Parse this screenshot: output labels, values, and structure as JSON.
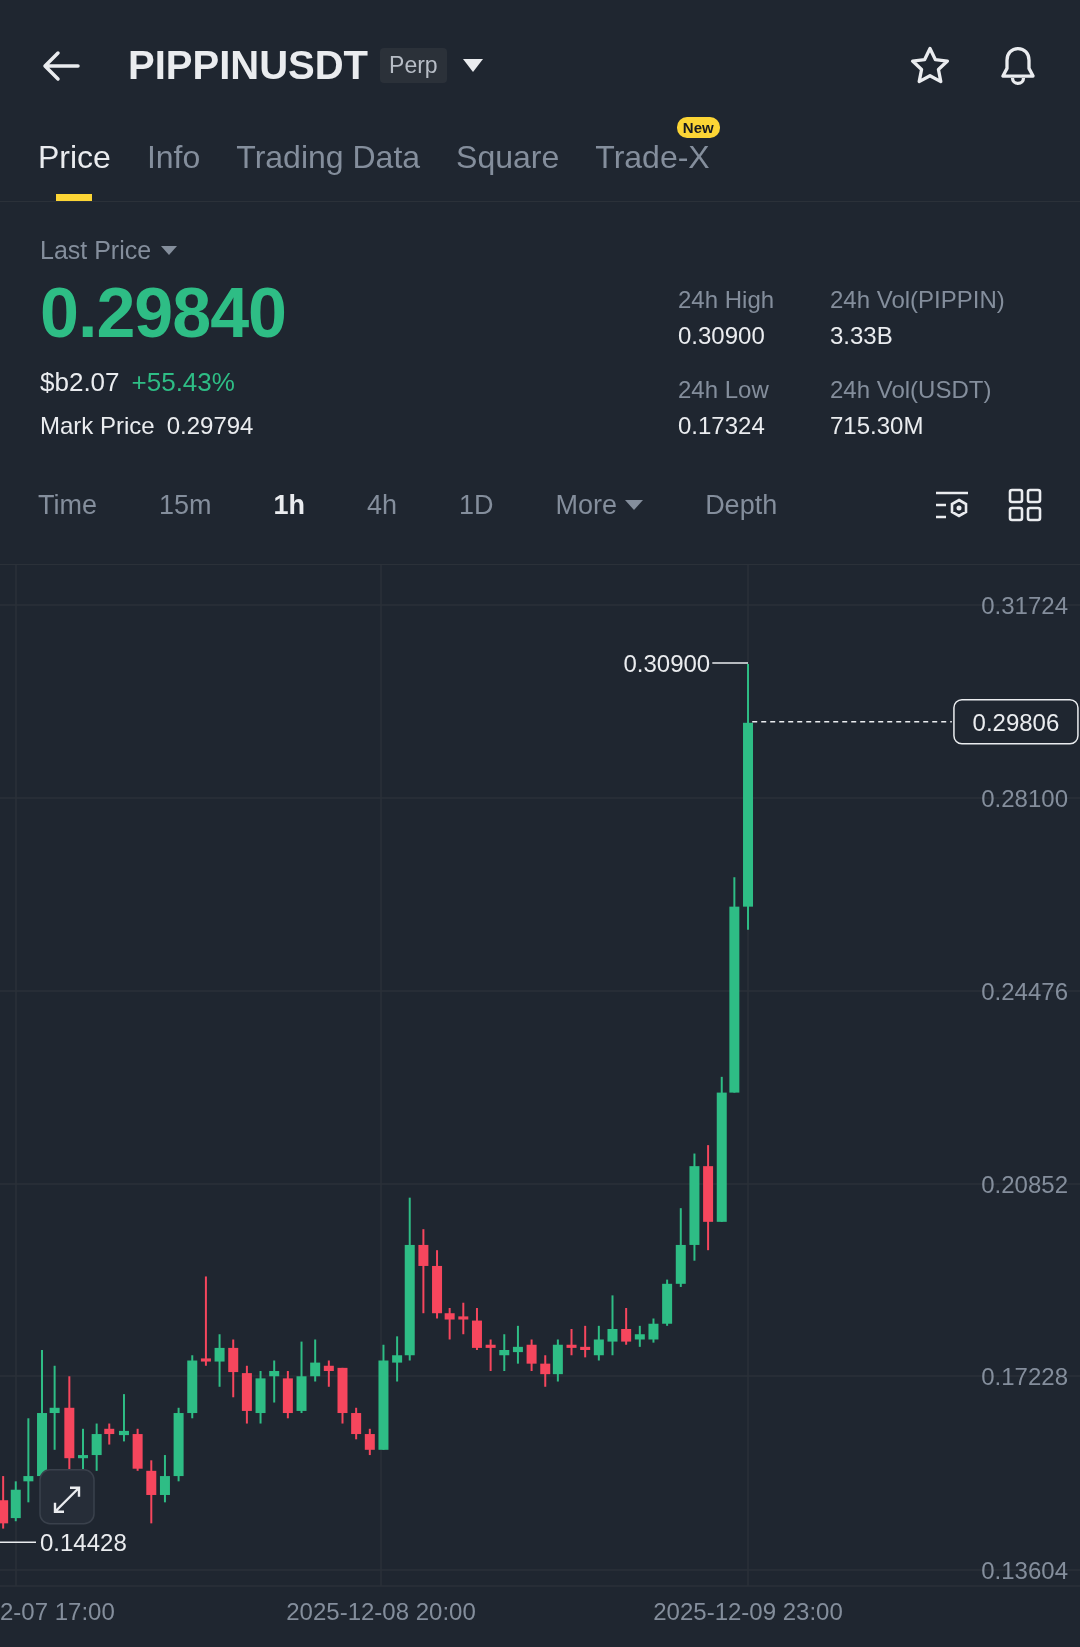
{
  "header": {
    "symbol": "PIPPINUSDT",
    "contract_badge": "Perp"
  },
  "tabs": [
    {
      "label": "Price",
      "selected": true
    },
    {
      "label": "Info",
      "selected": false
    },
    {
      "label": "Trading Data",
      "selected": false
    },
    {
      "label": "Square",
      "selected": false
    },
    {
      "label": "Trade-X",
      "selected": false,
      "badge": "New"
    }
  ],
  "ticker": {
    "last_price_label": "Last Price",
    "last_price": "0.29840",
    "fiat_value": "$b2.07",
    "change": "+55.43%",
    "mark_price_label": "Mark Price",
    "mark_price": "0.29794",
    "stats": [
      {
        "label": "24h High",
        "value": "0.30900"
      },
      {
        "label": "24h Vol(PIPPIN)",
        "value": "3.33B"
      },
      {
        "label": "24h Low",
        "value": "0.17324"
      },
      {
        "label": "24h Vol(USDT)",
        "value": "715.30M"
      }
    ]
  },
  "intervals": [
    {
      "label": "Time",
      "selected": false
    },
    {
      "label": "15m",
      "selected": false
    },
    {
      "label": "1h",
      "selected": true
    },
    {
      "label": "4h",
      "selected": false
    },
    {
      "label": "1D",
      "selected": false
    },
    {
      "label": "More",
      "selected": false,
      "kind": "dropdown"
    },
    {
      "label": "Depth",
      "selected": false
    }
  ],
  "chart": {
    "y_axis_labels": [
      "0.31724",
      "0.28100",
      "0.24476",
      "0.20852",
      "0.17228",
      "0.13604"
    ],
    "x_axis_labels": [
      "2-07 17:00",
      "2025-12-08 20:00",
      "2025-12-09 23:00"
    ],
    "high_marker": "0.30900",
    "last_price_marker": "0.29806",
    "low_marker": "0.14428"
  }
}
